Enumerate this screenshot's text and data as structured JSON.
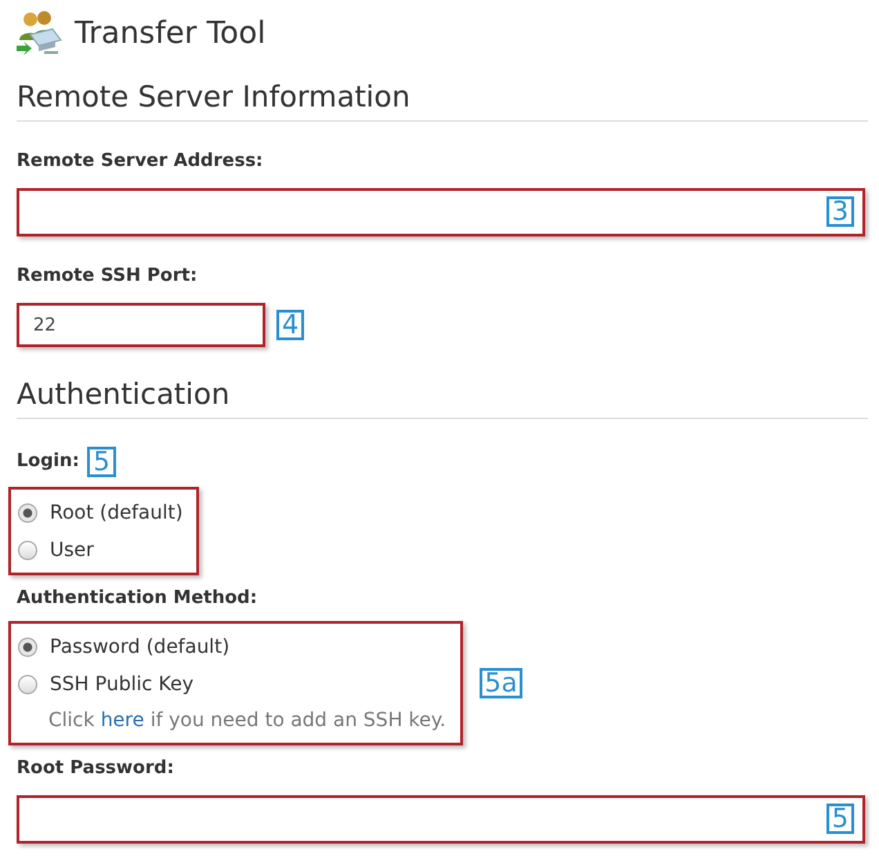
{
  "title": "Transfer Tool",
  "sections": [
    {
      "heading": "Remote Server Information",
      "items": [
        {
          "kind": "text",
          "label": "Remote Server Address:",
          "tag": "3"
        },
        {
          "kind": "short-text",
          "label": "Remote SSH Port:",
          "value": "22",
          "tag": "4"
        }
      ]
    },
    {
      "heading": "Authentication",
      "items": [
        {
          "kind": "radio",
          "label": "Login:",
          "label_tag": "5",
          "options": [
            {
              "label": "Root (default)",
              "selected": true
            },
            {
              "label": "User",
              "selected": false
            }
          ]
        },
        {
          "kind": "radio",
          "label": "Authentication Method:",
          "tag": "5a",
          "options": [
            {
              "label": "Password (default)",
              "selected": true
            },
            {
              "label": "SSH Public Key",
              "selected": false
            }
          ],
          "note": {
            "before": "Click ",
            "link": "here",
            "after": " if you need to add an SSH key."
          }
        },
        {
          "kind": "text",
          "label": "Root Password:",
          "tag": "5"
        }
      ]
    }
  ]
}
